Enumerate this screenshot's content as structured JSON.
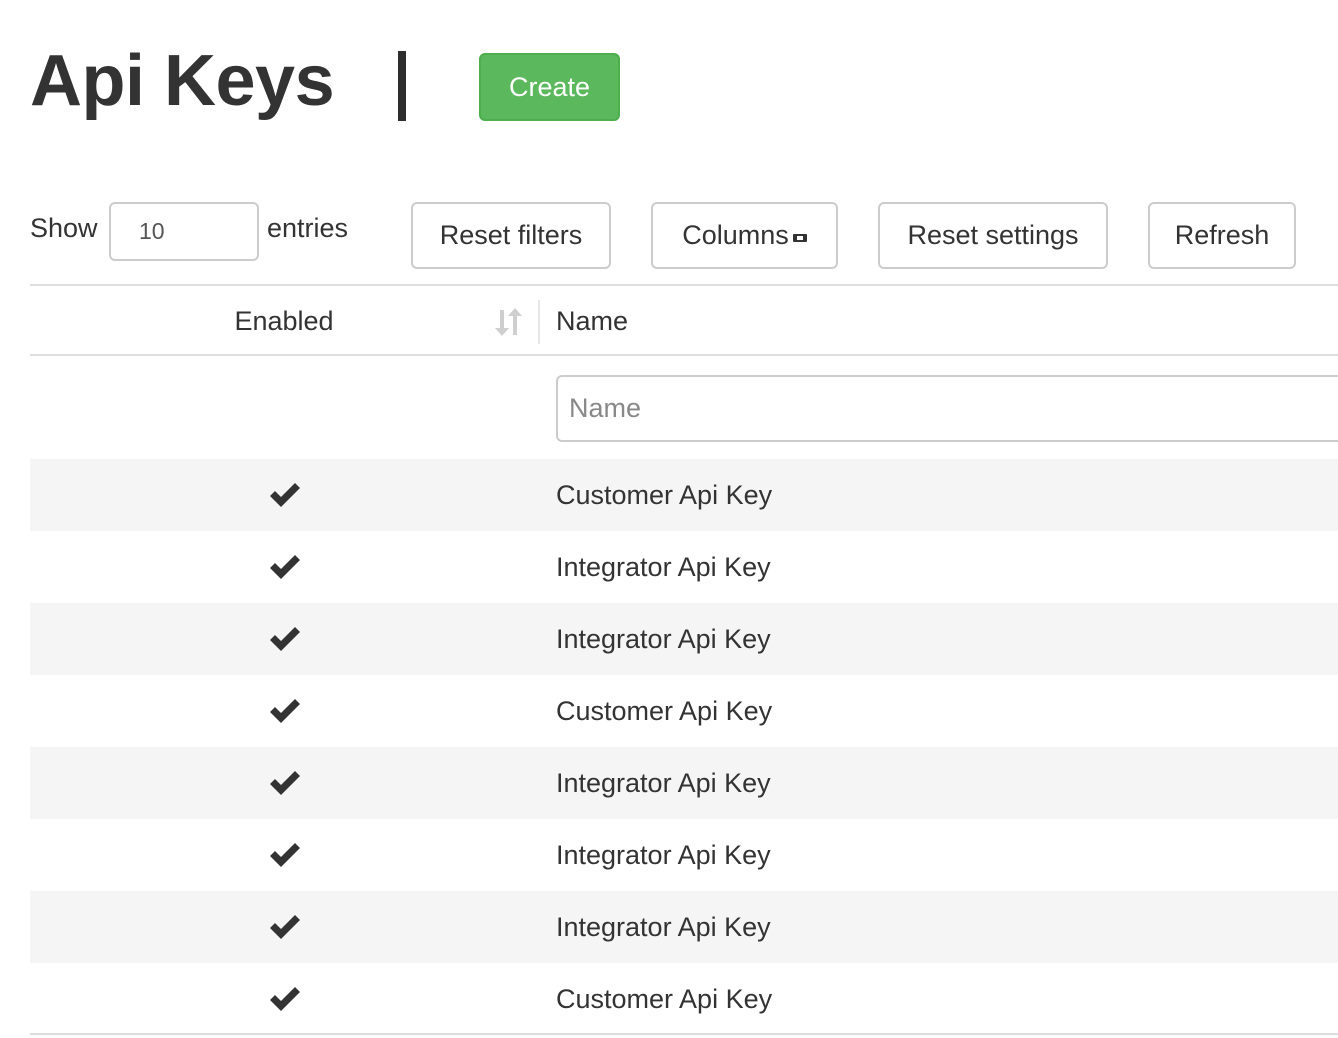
{
  "header": {
    "title": "Api Keys",
    "create_label": "Create"
  },
  "toolbar": {
    "show_label": "Show",
    "length_value": "10",
    "entries_label": "entries",
    "reset_filters_label": "Reset filters",
    "columns_label": "Columns",
    "reset_settings_label": "Reset settings",
    "refresh_label": "Refresh"
  },
  "table": {
    "columns": [
      {
        "label": "Enabled",
        "sort_icon": "sort-icon"
      },
      {
        "label": "Name"
      }
    ],
    "name_filter_placeholder": "Name",
    "rows": [
      {
        "enabled": true,
        "name": "Customer Api Key"
      },
      {
        "enabled": true,
        "name": "Integrator Api Key"
      },
      {
        "enabled": true,
        "name": "Integrator Api Key"
      },
      {
        "enabled": true,
        "name": "Customer Api Key"
      },
      {
        "enabled": true,
        "name": "Integrator Api Key"
      },
      {
        "enabled": true,
        "name": "Integrator Api Key"
      },
      {
        "enabled": true,
        "name": "Integrator Api Key"
      },
      {
        "enabled": true,
        "name": "Customer Api Key"
      }
    ]
  },
  "colors": {
    "create_button": "#5cb85c",
    "striped_row": "#f5f5f5",
    "text": "#333333"
  }
}
